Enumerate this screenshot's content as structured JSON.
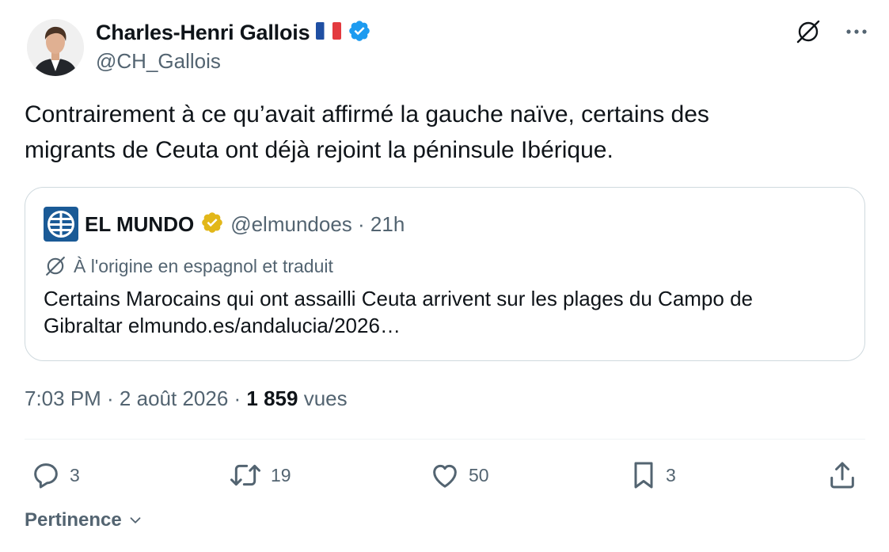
{
  "author": {
    "name": "Charles-Henri Gallois",
    "flag": "🇫🇷",
    "handle": "@CH_Gallois",
    "verified_color": "#1d9bf0"
  },
  "tweet": {
    "text_line1": "Contrairement à ce qu’avait affirmé la gauche naïve, certains des",
    "text_line2": "migrants de Ceuta ont déjà rejoint la péninsule Ibérique."
  },
  "quote": {
    "name": "EL MUNDO",
    "handle": "@elmundoes · 21h",
    "translated_note": "À l'origine en espagnol et traduit",
    "text_line1": "Certains Marocains qui ont assailli Ceuta arrivent sur les plages du Campo de",
    "text_line2": "Gibraltar elmundo.es/andalucia/2026…",
    "verified_color": "#e2b719",
    "logo_color": "#1a5a96"
  },
  "meta": {
    "time_date": "7:03 PM · 2 août 2026 · ",
    "views_count": "1 859",
    "views_label": " vues"
  },
  "actions": {
    "reply_count": "3",
    "retweet_count": "19",
    "like_count": "50",
    "bookmark_count": "3"
  },
  "sort": {
    "label": "Pertinence"
  },
  "icons": [
    "translate-icon",
    "more-icon",
    "reply-icon",
    "retweet-icon",
    "like-icon",
    "bookmark-icon",
    "share-icon",
    "chevron-down-icon",
    "verified-badge-icon"
  ],
  "colors": {
    "text_primary": "#0f1419",
    "text_secondary": "#536471",
    "border": "#cfd9de"
  }
}
